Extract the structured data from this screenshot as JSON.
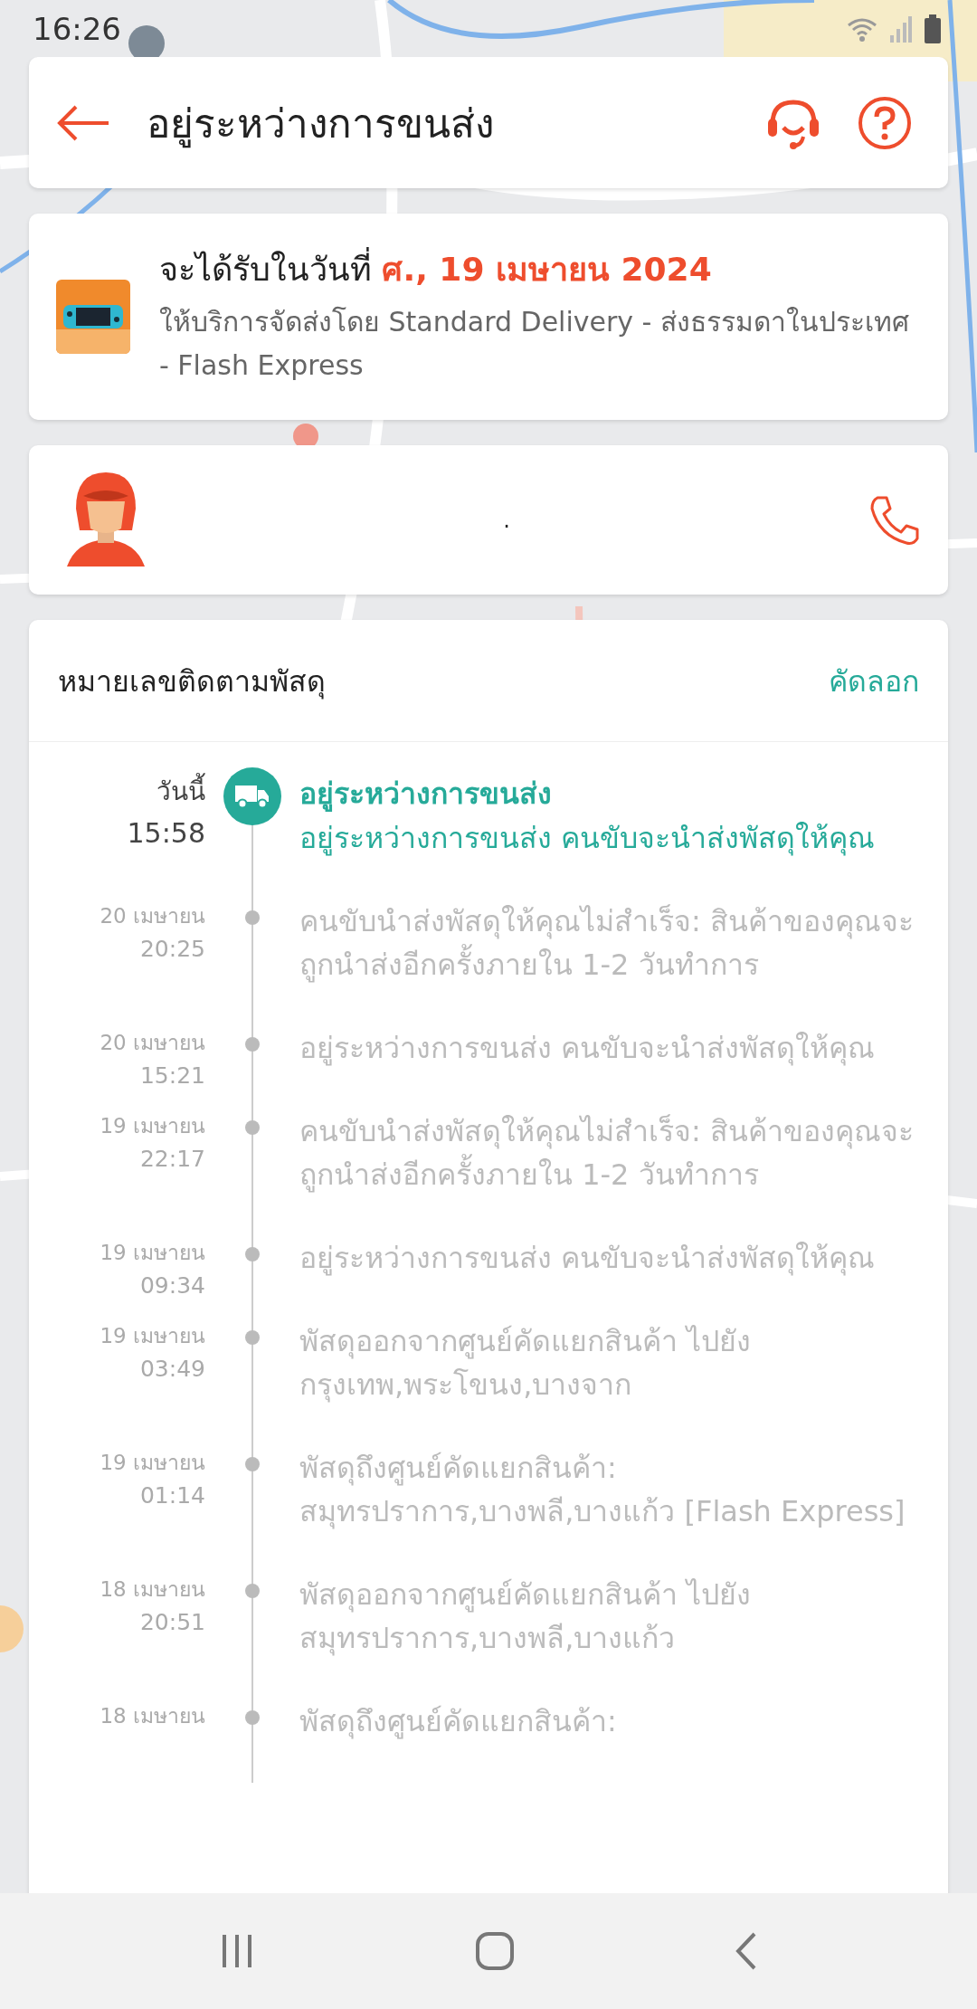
{
  "status_bar": {
    "time": "16:26"
  },
  "header": {
    "title": "อยู่ระหว่างการขนส่ง"
  },
  "delivery": {
    "label": "จะได้รับในวันที่",
    "date": "ศ., 19 เมษายน 2024",
    "service": "ให้บริการจัดส่งโดย Standard Delivery - ส่งธรรมดาในประเทศ - Flash Express"
  },
  "courier": {
    "name": "."
  },
  "tracking": {
    "title": "หมายเลขติดตามพัสดุ",
    "copy": "คัดลอก",
    "events": [
      {
        "active": true,
        "date": "วันนี้",
        "time": "15:58",
        "title": "อยู่ระหว่างการขนส่ง",
        "text": "อยู่ระหว่างการขนส่ง คนขับจะนำส่งพัสดุให้คุณ"
      },
      {
        "active": false,
        "date": "20 เมษายน",
        "time": "20:25",
        "text": "คนขับนำส่งพัสดุให้คุณไม่สำเร็จ: สินค้าของคุณจะถูกนำส่งอีกครั้งภายใน 1-2 วันทำการ"
      },
      {
        "active": false,
        "date": "20 เมษายน",
        "time": "15:21",
        "text": "อยู่ระหว่างการขนส่ง คนขับจะนำส่งพัสดุให้คุณ"
      },
      {
        "active": false,
        "date": "19 เมษายน",
        "time": "22:17",
        "text": "คนขับนำส่งพัสดุให้คุณไม่สำเร็จ: สินค้าของคุณจะถูกนำส่งอีกครั้งภายใน 1-2 วันทำการ"
      },
      {
        "active": false,
        "date": "19 เมษายน",
        "time": "09:34",
        "text": "อยู่ระหว่างการขนส่ง คนขับจะนำส่งพัสดุให้คุณ"
      },
      {
        "active": false,
        "date": "19 เมษายน",
        "time": "03:49",
        "text": "พัสดุออกจากศูนย์คัดแยกสินค้า ไปยัง กรุงเทพ,พระโขนง,บางจาก"
      },
      {
        "active": false,
        "date": "19 เมษายน",
        "time": "01:14",
        "text": "พัสดุถึงศูนย์คัดแยกสินค้า: สมุทรปราการ,บางพลี,บางแก้ว  [Flash Express]"
      },
      {
        "active": false,
        "date": "18 เมษายน",
        "time": "20:51",
        "text": "พัสดุออกจากศูนย์คัดแยกสินค้า ไปยัง สมุทรปราการ,บางพลี,บางแก้ว"
      },
      {
        "active": false,
        "date": "18 เมษายน",
        "text": "พัสดุถึงศูนย์คัดแยกสินค้า:"
      }
    ]
  }
}
